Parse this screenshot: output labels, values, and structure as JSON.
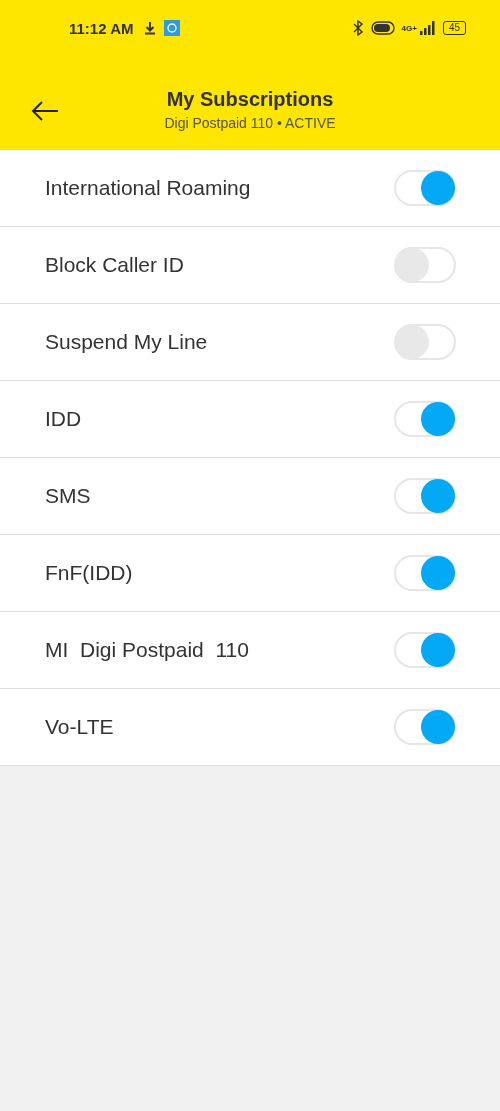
{
  "status_bar": {
    "time": "11:12 AM",
    "network": "4G+",
    "battery": "45"
  },
  "header": {
    "title": "My Subscriptions",
    "subtitle": "Digi Postpaid 110 • ACTIVE"
  },
  "subscriptions": [
    {
      "label": "International Roaming",
      "on": true
    },
    {
      "label": "Block Caller ID",
      "on": false
    },
    {
      "label": "Suspend My Line",
      "on": false
    },
    {
      "label": "IDD",
      "on": true
    },
    {
      "label": "SMS",
      "on": true
    },
    {
      "label": "FnF(IDD)",
      "on": true
    },
    {
      "label": "MI  Digi Postpaid  110",
      "on": true
    },
    {
      "label": "Vo-LTE",
      "on": true
    }
  ]
}
